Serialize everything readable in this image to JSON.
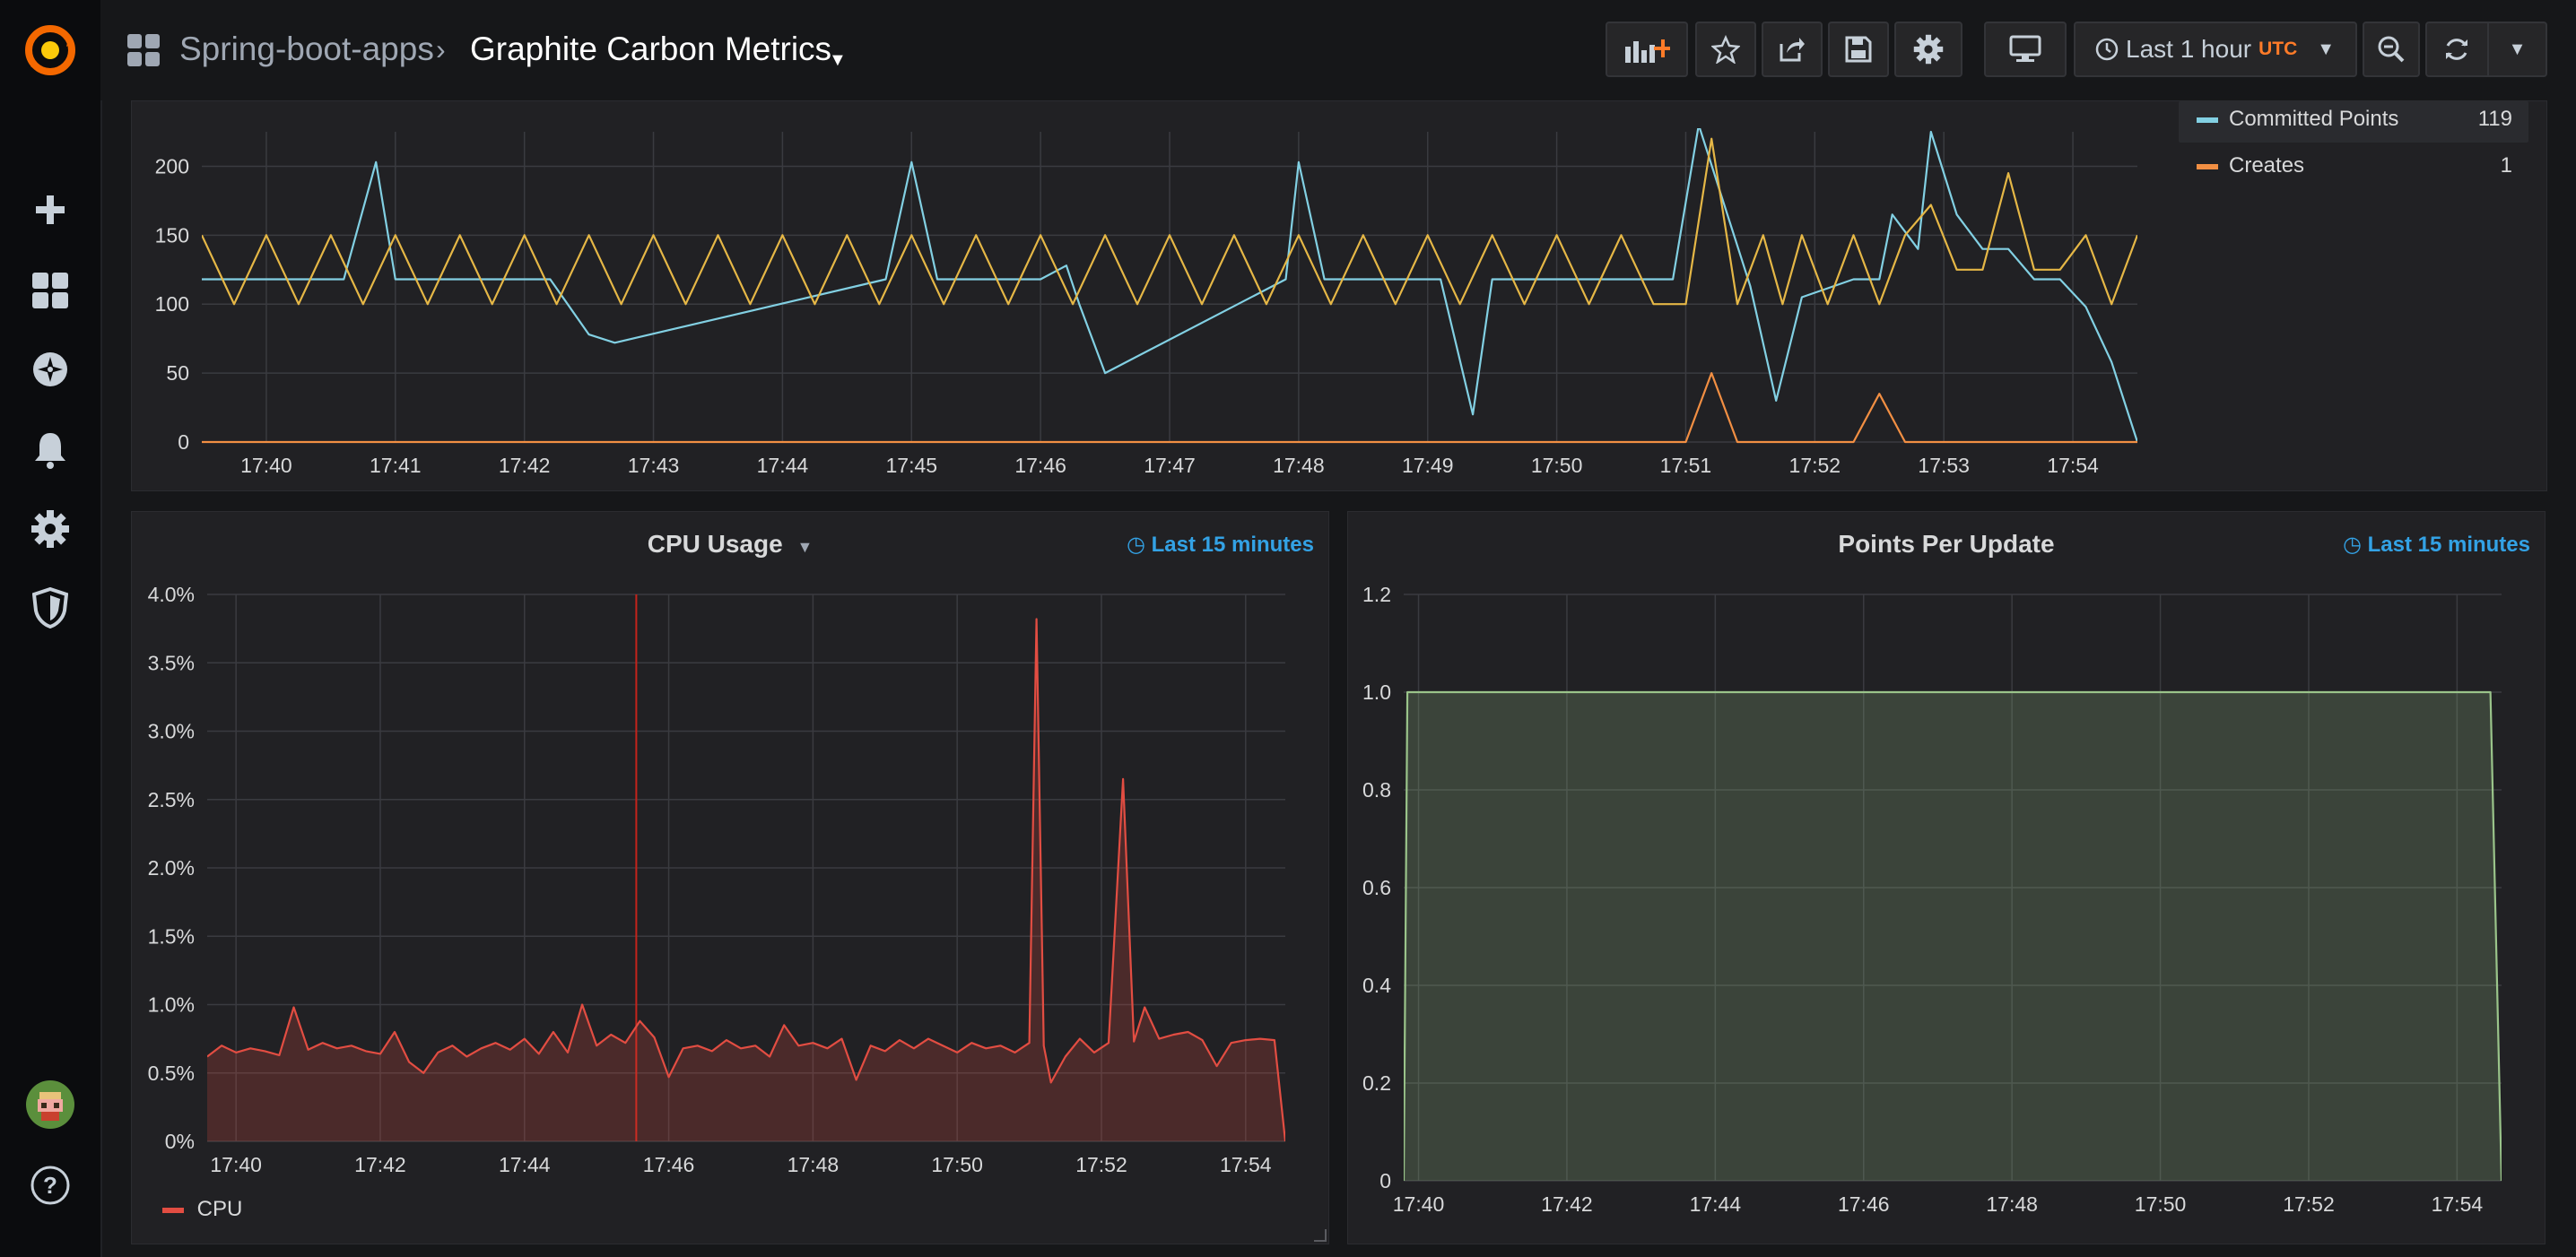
{
  "breadcrumb": {
    "folder": "Spring-boot-apps",
    "dashboard": "Graphite Carbon Metrics"
  },
  "time_picker": {
    "label": "Last 1 hour",
    "timezone": "UTC"
  },
  "colors": {
    "accent": "#ff7b28",
    "link": "#33a2e5",
    "committed": "#82d0e3",
    "updates": "#e5b746",
    "creates": "#f28f43",
    "cpu": "#e24d42",
    "points": "#9ac48a"
  },
  "top_panel": {
    "legend": [
      {
        "name": "Committed Points",
        "value": "119"
      },
      {
        "name": "Creates",
        "value": "1"
      }
    ]
  },
  "cpu_panel": {
    "title": "CPU Usage",
    "time_info": "Last 15 minutes",
    "legend": "CPU"
  },
  "points_panel": {
    "title": "Points Per Update",
    "time_info": "Last 15 minutes"
  },
  "chart_data": [
    {
      "type": "line",
      "title": "",
      "xlabel": "",
      "ylabel": "",
      "xlim": [
        "17:39.5",
        "17:54.5"
      ],
      "ylim": [
        0,
        225
      ],
      "x_ticks": [
        "17:40",
        "17:41",
        "17:42",
        "17:43",
        "17:44",
        "17:45",
        "17:46",
        "17:47",
        "17:48",
        "17:49",
        "17:50",
        "17:51",
        "17:52",
        "17:53",
        "17:54"
      ],
      "y_ticks": [
        0,
        50,
        100,
        150,
        200
      ],
      "grid": true,
      "legend_position": "right",
      "series": [
        {
          "name": "Committed Points",
          "color": "#82d0e3",
          "x": [
            "17:39.5",
            "17:40.6",
            "17:40.85",
            "17:41.0",
            "17:42.2",
            "17:42.5",
            "17:42.7",
            "17:44.8",
            "17:45.0",
            "17:45.2",
            "17:46.0",
            "17:46.2",
            "17:46.3",
            "17:46.5",
            "17:47.9",
            "17:48.0",
            "17:48.2",
            "17:49.1",
            "17:49.35",
            "17:49.5",
            "17:50.9",
            "17:51.1",
            "17:51.5",
            "17:51.7",
            "17:51.9",
            "17:52.3",
            "17:52.5",
            "17:52.6",
            "17:52.8",
            "17:52.9",
            "17:53.1",
            "17:53.3",
            "17:53.5",
            "17:53.7",
            "17:53.9",
            "17:54.1",
            "17:54.3",
            "17:54.5"
          ],
          "y": [
            118,
            118,
            203,
            118,
            118,
            78,
            72,
            118,
            203,
            118,
            118,
            128,
            100,
            50,
            118,
            203,
            118,
            118,
            20,
            118,
            118,
            230,
            113,
            30,
            105,
            118,
            118,
            165,
            140,
            225,
            165,
            140,
            140,
            118,
            118,
            98,
            58,
            0
          ]
        },
        {
          "name": "",
          "color": "#e5b746",
          "x": [
            "17:39.5",
            "17:39.75",
            "17:40.0",
            "17:40.25",
            "17:40.5",
            "17:40.75",
            "17:41.0",
            "17:41.25",
            "17:41.5",
            "17:41.75",
            "17:42.0",
            "17:42.25",
            "17:42.5",
            "17:42.75",
            "17:43.0",
            "17:43.25",
            "17:43.5",
            "17:43.75",
            "17:44.0",
            "17:44.25",
            "17:44.5",
            "17:44.75",
            "17:45.0",
            "17:45.25",
            "17:45.5",
            "17:45.75",
            "17:46.0",
            "17:46.25",
            "17:46.5",
            "17:46.75",
            "17:47.0",
            "17:47.25",
            "17:47.5",
            "17:47.75",
            "17:48.0",
            "17:48.25",
            "17:48.5",
            "17:48.75",
            "17:49.0",
            "17:49.25",
            "17:49.5",
            "17:49.75",
            "17:50.0",
            "17:50.25",
            "17:50.5",
            "17:50.75",
            "17:51.0",
            "17:51.2",
            "17:51.4",
            "17:51.6",
            "17:51.75",
            "17:51.9",
            "17:52.1",
            "17:52.3",
            "17:52.5",
            "17:52.7",
            "17:52.9",
            "17:53.1",
            "17:53.3",
            "17:53.5",
            "17:53.7",
            "17:53.9",
            "17:54.1",
            "17:54.3",
            "17:54.5"
          ],
          "y": [
            150,
            100,
            150,
            100,
            150,
            100,
            150,
            100,
            150,
            100,
            150,
            100,
            150,
            100,
            150,
            100,
            150,
            100,
            150,
            100,
            150,
            100,
            150,
            100,
            150,
            100,
            150,
            100,
            150,
            100,
            150,
            100,
            150,
            100,
            150,
            100,
            150,
            100,
            150,
            100,
            150,
            100,
            150,
            100,
            150,
            100,
            100,
            220,
            100,
            150,
            100,
            150,
            100,
            150,
            100,
            150,
            172,
            125,
            125,
            195,
            125,
            125,
            150,
            100,
            150
          ]
        },
        {
          "name": "Creates",
          "color": "#f28f43",
          "x": [
            "17:39.5",
            "17:51.0",
            "17:51.2",
            "17:51.4",
            "17:52.3",
            "17:52.5",
            "17:52.7",
            "17:54.5"
          ],
          "y": [
            0,
            0,
            50,
            0,
            0,
            35,
            0,
            0
          ]
        }
      ]
    },
    {
      "type": "area",
      "title": "CPU Usage",
      "xlabel": "",
      "ylabel": "",
      "xlim": [
        "17:39.6",
        "17:54.55"
      ],
      "ylim": [
        0,
        4.0
      ],
      "x_ticks": [
        "17:40",
        "17:42",
        "17:44",
        "17:46",
        "17:48",
        "17:50",
        "17:52",
        "17:54"
      ],
      "y_ticks": [
        "0%",
        "0.5%",
        "1.0%",
        "1.5%",
        "2.0%",
        "2.5%",
        "3.0%",
        "3.5%",
        "4.0%"
      ],
      "grid": true,
      "legend_position": "bottom-left",
      "series": [
        {
          "name": "CPU",
          "color": "#e24d42",
          "unit": "%",
          "x": [
            "17:39.6",
            "17:39.8",
            "17:40.0",
            "17:40.2",
            "17:40.4",
            "17:40.6",
            "17:40.8",
            "17:41.0",
            "17:41.2",
            "17:41.4",
            "17:41.6",
            "17:41.8",
            "17:42.0",
            "17:42.2",
            "17:42.4",
            "17:42.6",
            "17:42.8",
            "17:43.0",
            "17:43.2",
            "17:43.4",
            "17:43.6",
            "17:43.8",
            "17:44.0",
            "17:44.2",
            "17:44.4",
            "17:44.6",
            "17:44.8",
            "17:45.0",
            "17:45.2",
            "17:45.4",
            "17:45.6",
            "17:45.8",
            "17:46.0",
            "17:46.2",
            "17:46.4",
            "17:46.6",
            "17:46.8",
            "17:47.0",
            "17:47.2",
            "17:47.4",
            "17:47.6",
            "17:47.8",
            "17:48.0",
            "17:48.2",
            "17:48.4",
            "17:48.6",
            "17:48.8",
            "17:49.0",
            "17:49.2",
            "17:49.4",
            "17:49.6",
            "17:49.8",
            "17:50.0",
            "17:50.2",
            "17:50.4",
            "17:50.6",
            "17:50.8",
            "17:51.0",
            "17:51.1",
            "17:51.2",
            "17:51.3",
            "17:51.5",
            "17:51.7",
            "17:51.9",
            "17:52.1",
            "17:52.3",
            "17:52.45",
            "17:52.6",
            "17:52.8",
            "17:53.0",
            "17:53.2",
            "17:53.4",
            "17:53.6",
            "17:53.8",
            "17:54.0",
            "17:54.2",
            "17:54.4",
            "17:54.55"
          ],
          "y": [
            0.62,
            0.7,
            0.65,
            0.68,
            0.66,
            0.63,
            0.98,
            0.67,
            0.72,
            0.68,
            0.7,
            0.66,
            0.64,
            0.8,
            0.58,
            0.5,
            0.65,
            0.7,
            0.62,
            0.68,
            0.72,
            0.67,
            0.75,
            0.64,
            0.8,
            0.65,
            1.0,
            0.7,
            0.78,
            0.72,
            0.88,
            0.76,
            0.47,
            0.68,
            0.7,
            0.66,
            0.74,
            0.68,
            0.7,
            0.62,
            0.85,
            0.7,
            0.72,
            0.68,
            0.75,
            0.45,
            0.7,
            0.66,
            0.74,
            0.68,
            0.75,
            0.7,
            0.65,
            0.72,
            0.68,
            0.7,
            0.65,
            0.72,
            3.82,
            0.7,
            0.43,
            0.62,
            0.75,
            0.65,
            0.72,
            2.65,
            0.73,
            0.98,
            0.75,
            0.78,
            0.8,
            0.74,
            0.55,
            0.72,
            0.74,
            0.75,
            0.74,
            0.0
          ]
        }
      ],
      "annotation_x": "17:45.55"
    },
    {
      "type": "area",
      "title": "Points Per Update",
      "xlabel": "",
      "ylabel": "",
      "xlim": [
        "17:39.8",
        "17:54.6"
      ],
      "ylim": [
        0,
        1.2
      ],
      "x_ticks": [
        "17:40",
        "17:42",
        "17:44",
        "17:46",
        "17:48",
        "17:50",
        "17:52",
        "17:54"
      ],
      "y_ticks": [
        "0",
        "0.2",
        "0.4",
        "0.6",
        "0.8",
        "1.0",
        "1.2"
      ],
      "grid": true,
      "legend_position": "none",
      "series": [
        {
          "name": "",
          "color": "#9ac48a",
          "x": [
            "17:39.8",
            "17:39.85",
            "17:54.45",
            "17:54.6"
          ],
          "y": [
            0,
            1.0,
            1.0,
            0
          ]
        }
      ]
    }
  ]
}
